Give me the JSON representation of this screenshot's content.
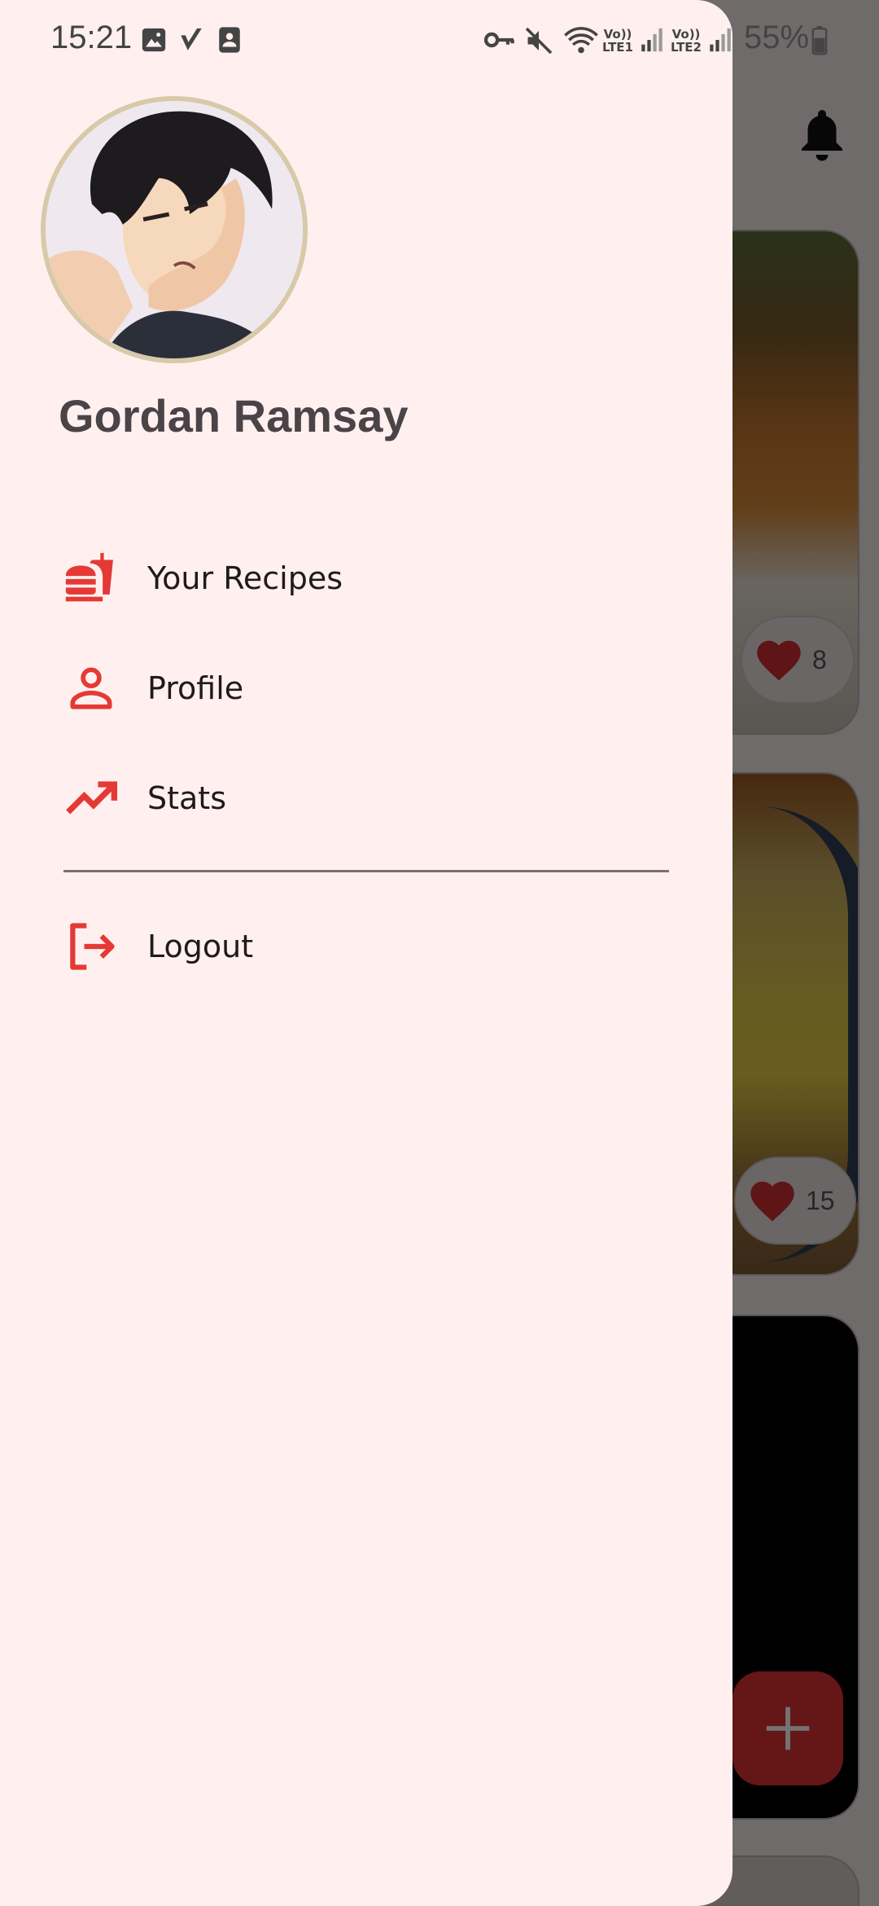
{
  "status_bar": {
    "time": "15:21",
    "battery_percent": "55%",
    "sim1_label": "Vo))\nLTE1",
    "sim2_label": "Vo))\nLTE2",
    "left_icons": [
      "image-icon",
      "check-v-icon",
      "contact-card-icon"
    ],
    "right_icons": [
      "vpn-key-icon",
      "mute-icon",
      "wifi-icon",
      "signal-icon",
      "signal-icon",
      "battery-icon"
    ]
  },
  "drawer": {
    "user_name": "Gordan Ramsay",
    "menu": [
      {
        "label": "Your Recipes",
        "icon": "fast-food-icon"
      },
      {
        "label": "Profile",
        "icon": "person-icon"
      },
      {
        "label": "Stats",
        "icon": "trending-up-icon"
      }
    ],
    "logout": {
      "label": "Logout",
      "icon": "logout-icon"
    }
  },
  "background": {
    "notification_icon": "bell-icon",
    "cards": [
      {
        "likes": "8"
      },
      {
        "likes": "15"
      }
    ],
    "fab_icon": "plus-icon"
  },
  "colors": {
    "accent": "#e53935",
    "drawer_bg": "#fff0ef",
    "text": "#1f1a1c"
  }
}
